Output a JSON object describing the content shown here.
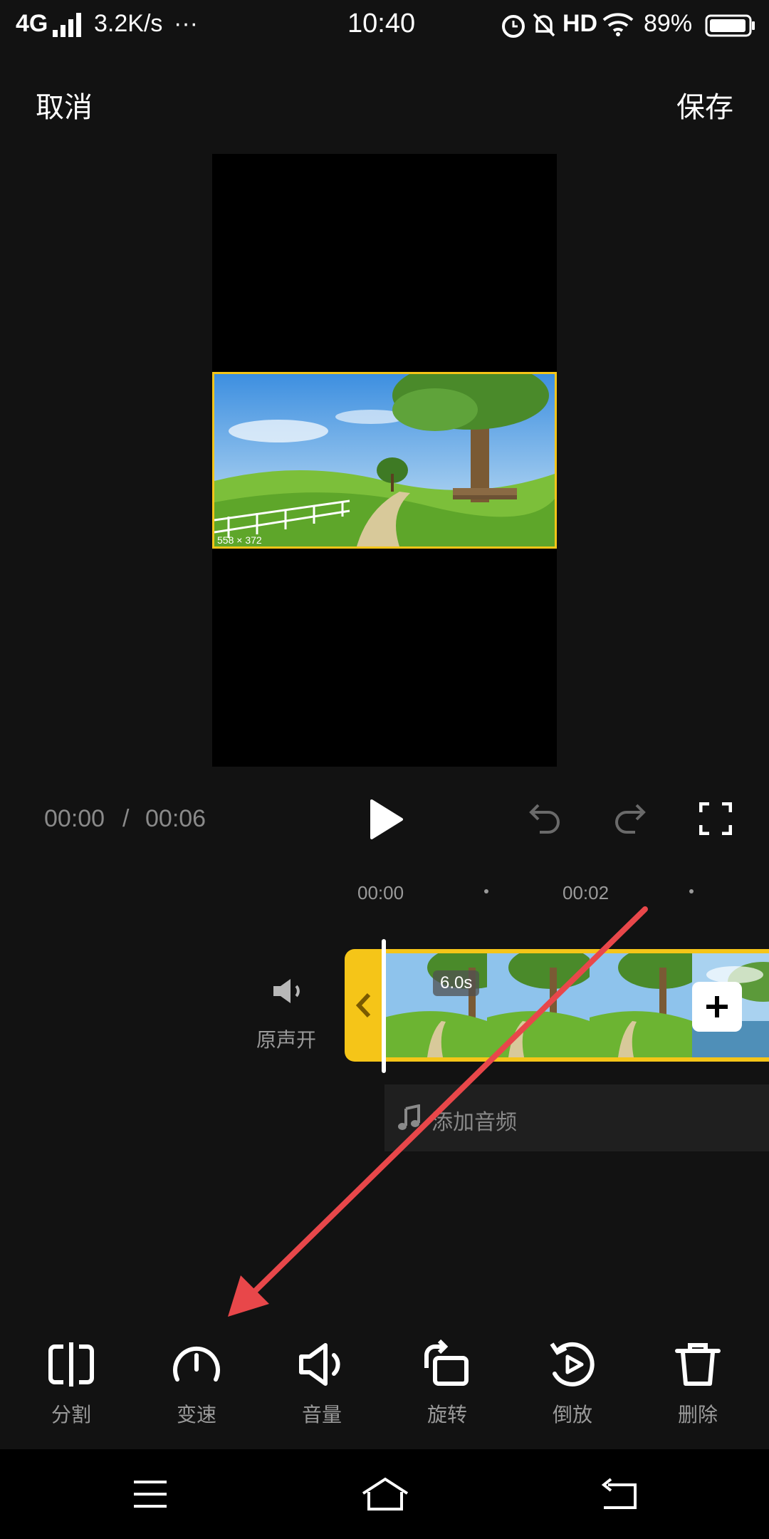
{
  "status_bar": {
    "network": "4G",
    "speed": "3.2K/s",
    "more": "···",
    "time": "10:40",
    "hd": "HD",
    "battery": "89%"
  },
  "header": {
    "cancel": "取消",
    "save": "保存"
  },
  "preview": {
    "watermark": "558 × 372"
  },
  "player": {
    "current": "00:00",
    "separator": "/",
    "total": "00:06"
  },
  "timeline": {
    "ticks": [
      "00:00",
      "00:02"
    ],
    "original_sound": "原声开",
    "clip_duration": "6.0s",
    "add_audio": "添加音频"
  },
  "toolbar": [
    {
      "label": "分割",
      "icon": "split-icon"
    },
    {
      "label": "变速",
      "icon": "speed-icon"
    },
    {
      "label": "音量",
      "icon": "volume-icon"
    },
    {
      "label": "旋转",
      "icon": "rotate-icon"
    },
    {
      "label": "倒放",
      "icon": "reverse-icon"
    },
    {
      "label": "删除",
      "icon": "delete-icon"
    }
  ],
  "colors": {
    "accent": "#f5c518",
    "background": "#121212",
    "arrow": "#e8474a"
  }
}
